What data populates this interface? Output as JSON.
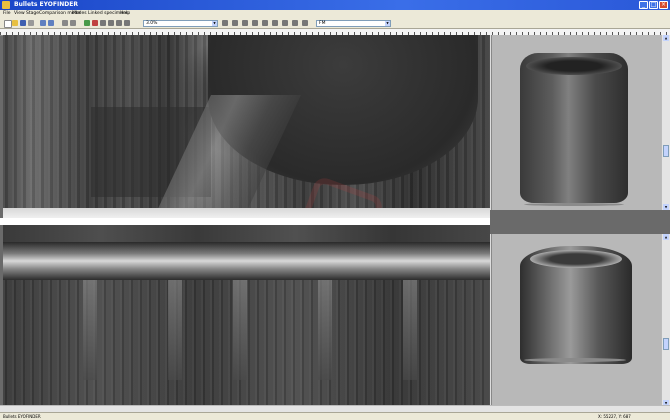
{
  "window": {
    "title": "Bullets EYOFINDER",
    "buttons": {
      "minimize": "_",
      "maximize": "□",
      "close": "×"
    }
  },
  "menu": {
    "items": [
      "File",
      "View",
      "Stage",
      "Comparison mode",
      "Modes",
      "Linked specimens",
      "Help"
    ]
  },
  "toolbar": {
    "zoom_value": "3.0%",
    "mode_value": "FM"
  },
  "status": {
    "left_text": "Bullets EYOFINDER",
    "right_text": "X: 55227, Y: 687"
  },
  "icons": {
    "app": "app-icon",
    "toolbar": [
      "new-icon",
      "open-icon",
      "save-icon",
      "print-icon",
      "undo-icon",
      "redo-icon",
      "zoom-in-icon",
      "zoom-out-icon",
      "play-icon",
      "stop-icon",
      "first-icon",
      "prev-icon",
      "next-icon",
      "last-icon"
    ]
  },
  "colors": {
    "titlebar": "#2a58d8",
    "chrome": "#ece9d8",
    "thumb_bg": "#b8b8b8"
  }
}
